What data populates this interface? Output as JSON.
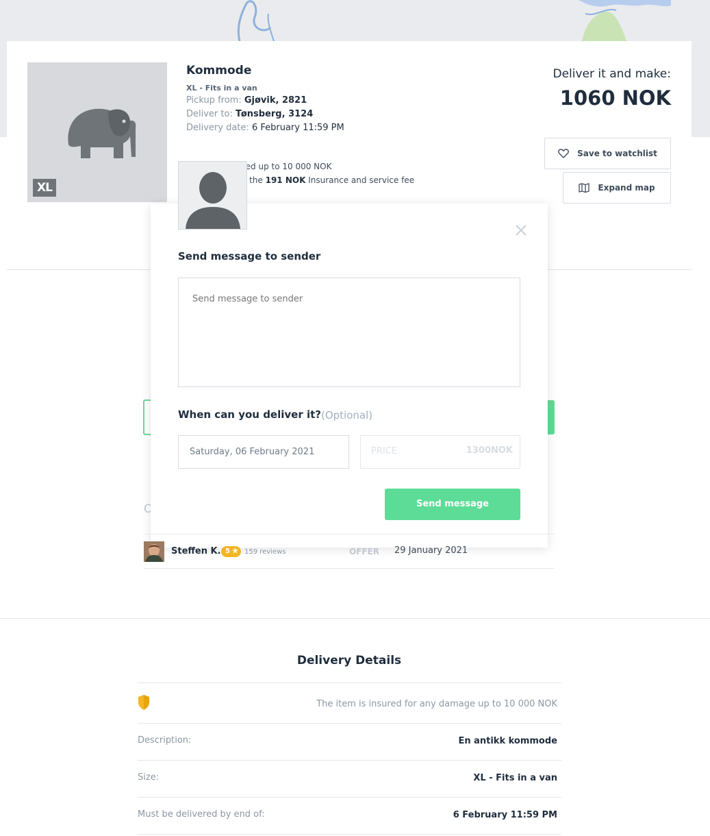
{
  "listing": {
    "title": "Kommode",
    "size_label": "XL - Fits in a van",
    "badge": "XL",
    "pickup_label": "Pickup from:",
    "pickup_value": "Gjøvik, 2821",
    "deliver_label": "Deliver to:",
    "deliver_value": "Tønsberg, 3124",
    "date_label": "Delivery date:",
    "date_value": "6 February 11:59 PM",
    "make_label": "Deliver it and make:",
    "make_price": "1060 NOK",
    "insured_text": "red up to 10 000 NOK",
    "fee_prefix": "s the",
    "fee_amount": "191 NOK",
    "fee_suffix": "Insurance and service fee"
  },
  "actions": {
    "watchlist": "Save to watchlist",
    "expand_map": "Expand map"
  },
  "modal": {
    "title": "Send message to sender",
    "message_placeholder": "Send message to sender",
    "when_label": "When can you deliver it?",
    "optional_label": "(Optional)",
    "date_value": "Saturday, 06 February 2021",
    "price_placeholder": "PRICE",
    "price_value": "1300NOK",
    "send_label": "Send message"
  },
  "offers": {
    "partial_heading_letter": "O",
    "rows": [
      {
        "name": "Steffen K.",
        "rating": "5",
        "reviews": "159 reviews",
        "tag": "OFFER",
        "date": "29 January 2021"
      }
    ]
  },
  "details": {
    "title": "Delivery Details",
    "insurance_note": "The item is insured for any damage up to 10 000 NOK",
    "description_label": "Description:",
    "description_value": "En antikk kommode",
    "size_label": "Size:",
    "size_value": "XL - Fits in a van",
    "deadline_label": "Must be delivered by end of:",
    "deadline_value": "6 February 11:59 PM"
  },
  "colors": {
    "accent_green": "#5ddc97",
    "rating_gold": "#f5b623",
    "text_dark": "#1f2d3d",
    "text_muted": "#8a96a3"
  },
  "icons": [
    "elephant-icon",
    "heart-icon",
    "map-icon",
    "close-icon",
    "user-placeholder-icon",
    "star-icon",
    "shield-icon"
  ]
}
